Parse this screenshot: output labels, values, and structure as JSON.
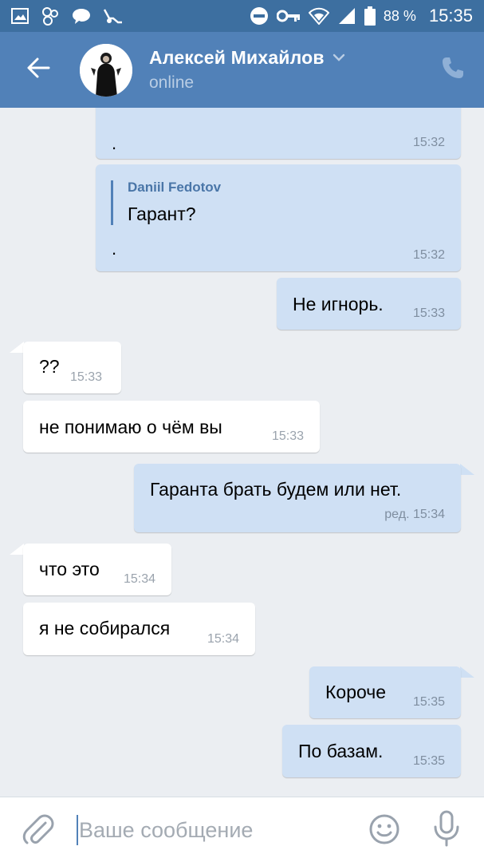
{
  "status_bar": {
    "battery": "88 %",
    "time": "15:35"
  },
  "header": {
    "name": "Алексей Михайлов",
    "status": "online"
  },
  "messages": [
    {
      "dir": "out",
      "reply_author": "",
      "text": ".",
      "time": "15:32"
    },
    {
      "dir": "out",
      "reply_author": "Daniil Fedotov",
      "reply_text": "Гарант?",
      "text": ".",
      "time": "15:32"
    },
    {
      "dir": "out",
      "text": "Не игнорь.",
      "time": "15:33"
    },
    {
      "dir": "in",
      "text": "??",
      "time": "15:33"
    },
    {
      "dir": "in",
      "text": "не понимаю о чём вы",
      "time": "15:33"
    },
    {
      "dir": "out",
      "text": "Гаранта брать будем или нет.",
      "time": "ред. 15:34"
    },
    {
      "dir": "in",
      "text": "что это",
      "time": "15:34"
    },
    {
      "dir": "in",
      "text": "я не собирался",
      "time": "15:34"
    },
    {
      "dir": "out",
      "text": "Короче",
      "time": "15:35"
    },
    {
      "dir": "out",
      "text": "По базам.",
      "time": "15:35"
    }
  ],
  "composer": {
    "placeholder": "Ваше сообщение"
  },
  "colors": {
    "status_bar": "#3d6fa0",
    "header": "#5181b8",
    "outgoing_bubble": "#cfe0f4",
    "incoming_bubble": "#ffffff",
    "chat_background": "#ebeef2"
  },
  "icons": [
    "gallery-icon",
    "community-icon",
    "chat-notification-icon",
    "app-notification-icon",
    "do-not-disturb-icon",
    "vpn-key-icon",
    "wifi-icon",
    "cell-signal-icon",
    "battery-icon",
    "back-arrow-icon",
    "chevron-down-icon",
    "phone-icon",
    "paperclip-icon",
    "emoji-icon",
    "microphone-icon"
  ]
}
